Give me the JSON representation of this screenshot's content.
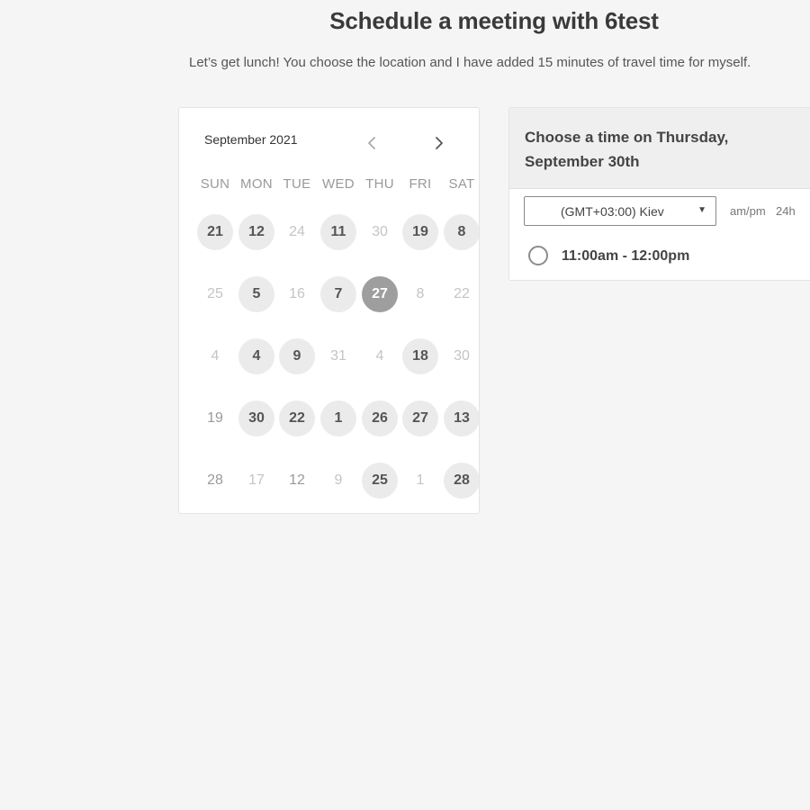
{
  "header": {
    "title": "Schedule a meeting with 6test",
    "description": "Let’s get lunch! You choose the location and I have added 15 minutes of travel time for myself."
  },
  "calendar": {
    "month_label": "September 2021",
    "prev_icon": "chevron-left-icon",
    "next_icon": "chevron-right-icon",
    "weekdays": [
      "SUN",
      "MON",
      "TUE",
      "WED",
      "THU",
      "FRI",
      "SAT"
    ],
    "weeks": [
      [
        {
          "label": "21",
          "state": "available"
        },
        {
          "label": "12",
          "state": "available"
        },
        {
          "label": "24",
          "state": "unavailable"
        },
        {
          "label": "11",
          "state": "available"
        },
        {
          "label": "30",
          "state": "unavailable"
        },
        {
          "label": "19",
          "state": "available"
        },
        {
          "label": "8",
          "state": "available"
        }
      ],
      [
        {
          "label": "25",
          "state": "unavailable"
        },
        {
          "label": "5",
          "state": "available"
        },
        {
          "label": "16",
          "state": "unavailable"
        },
        {
          "label": "7",
          "state": "available"
        },
        {
          "label": "27",
          "state": "selected"
        },
        {
          "label": "8",
          "state": "unavailable"
        },
        {
          "label": "22",
          "state": "unavailable"
        }
      ],
      [
        {
          "label": "4",
          "state": "unavailable"
        },
        {
          "label": "4",
          "state": "available"
        },
        {
          "label": "9",
          "state": "available"
        },
        {
          "label": "31",
          "state": "unavailable"
        },
        {
          "label": "4",
          "state": "unavailable"
        },
        {
          "label": "18",
          "state": "available"
        },
        {
          "label": "30",
          "state": "unavailable"
        }
      ],
      [
        {
          "label": "19",
          "state": "plain"
        },
        {
          "label": "30",
          "state": "available"
        },
        {
          "label": "22",
          "state": "available"
        },
        {
          "label": "1",
          "state": "available"
        },
        {
          "label": "26",
          "state": "available"
        },
        {
          "label": "27",
          "state": "available"
        },
        {
          "label": "13",
          "state": "available"
        }
      ],
      [
        {
          "label": "28",
          "state": "plain"
        },
        {
          "label": "17",
          "state": "unavailable"
        },
        {
          "label": "12",
          "state": "plain"
        },
        {
          "label": "9",
          "state": "unavailable"
        },
        {
          "label": "25",
          "state": "available"
        },
        {
          "label": "1",
          "state": "unavailable"
        },
        {
          "label": "28",
          "state": "available"
        }
      ]
    ]
  },
  "times": {
    "title": "Choose a time on Thursday, September 30th",
    "timezone": "(GMT+03:00) Kiev",
    "dropdown_icon": "caret-down-icon",
    "format_ampm": "am/pm",
    "format_24h": "24h",
    "slots": [
      {
        "label": "11:00am - 12:00pm"
      }
    ]
  },
  "colors": {
    "background": "#f5f5f5",
    "available_day": "#ebebeb",
    "selected_day": "#9e9e9e",
    "panel_header": "#efefef"
  }
}
